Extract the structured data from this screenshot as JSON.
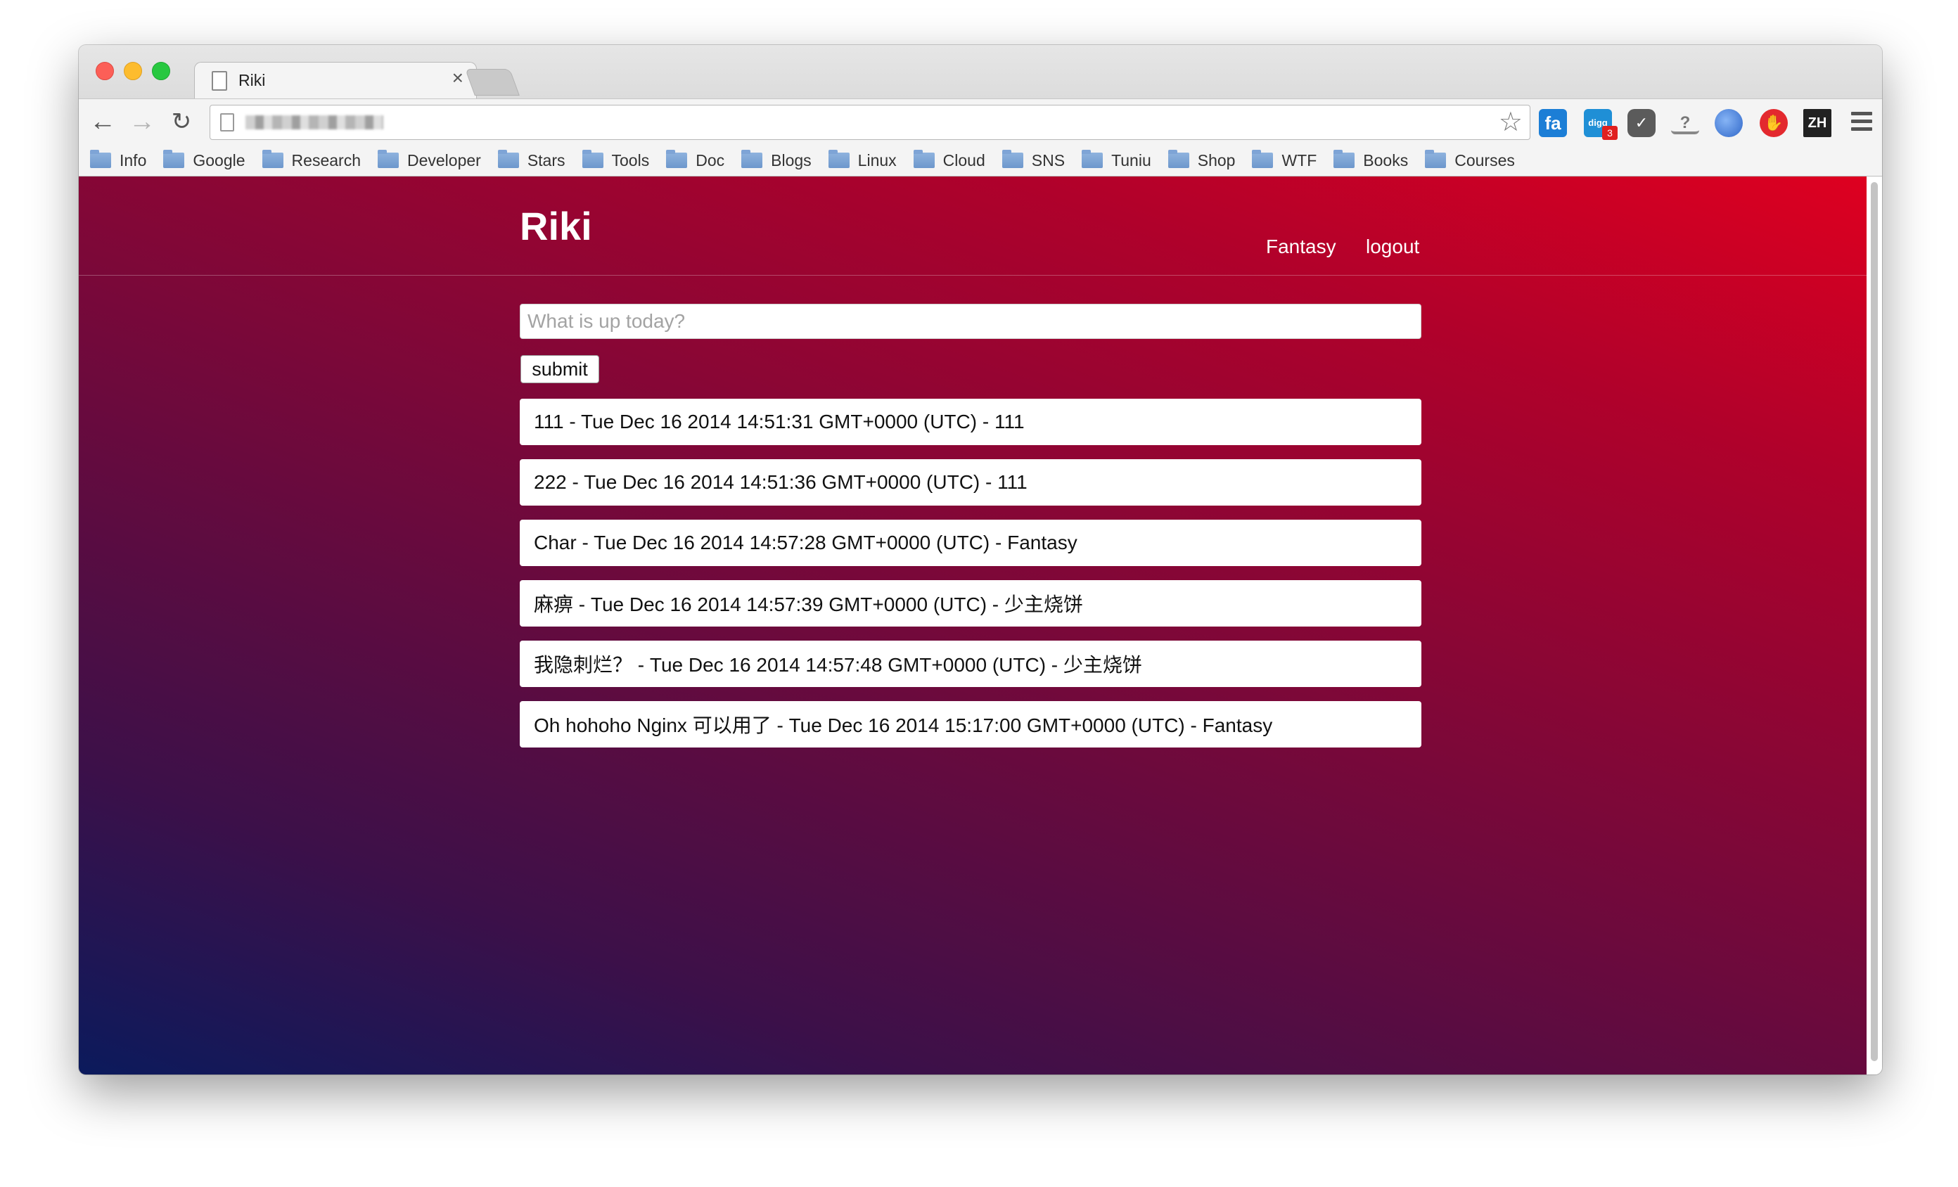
{
  "browser": {
    "tab_title": "Riki",
    "tab_close": "×",
    "bookmarks": [
      "Info",
      "Google",
      "Research",
      "Developer",
      "Stars",
      "Tools",
      "Doc",
      "Blogs",
      "Linux",
      "Cloud",
      "SNS",
      "Tuniu",
      "Shop",
      "WTF",
      "Books",
      "Courses"
    ],
    "extensions": {
      "fa_label": "fa",
      "digg_label": "digg",
      "digg_badge": "3",
      "zh_label": "ZH"
    }
  },
  "site": {
    "brand": "Riki",
    "nav": {
      "user_link": "Fantasy",
      "logout_link": "logout"
    },
    "composer": {
      "placeholder": "What is up today?",
      "submit_label": "submit"
    },
    "feed": [
      "111 - Tue Dec 16 2014 14:51:31 GMT+0000 (UTC) - 111",
      "222 - Tue Dec 16 2014 14:51:36 GMT+0000 (UTC) - 111",
      "Char - Tue Dec 16 2014 14:57:28 GMT+0000 (UTC) - Fantasy",
      "麻痹 - Tue Dec 16 2014 14:57:39 GMT+0000 (UTC) - 少主烧饼",
      "我隐刺烂？ - Tue Dec 16 2014 14:57:48 GMT+0000 (UTC) - 少主烧饼",
      "Oh hohoho Nginx 可以用了 - Tue Dec 16 2014 15:17:00 GMT+0000 (UTC) - Fantasy"
    ]
  },
  "colors": {
    "gradient_start": "#0b1a5c",
    "gradient_mid": "#7a0839",
    "gradient_end": "#de0020"
  }
}
